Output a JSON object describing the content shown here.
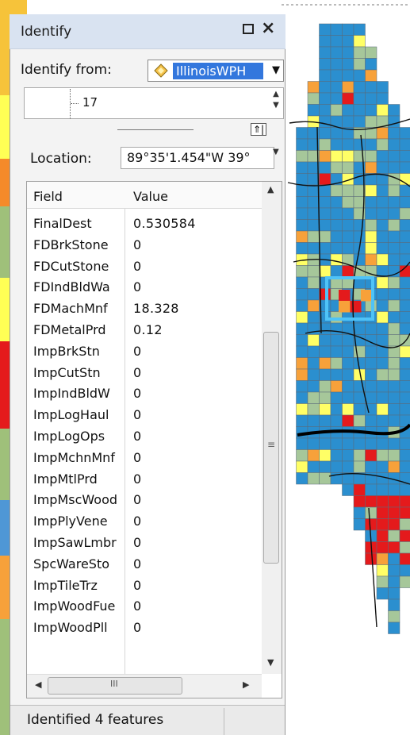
{
  "window": {
    "title": "Identify",
    "float_icon": "maximize-icon",
    "close_glyph": "×",
    "close_icon": "close-icon"
  },
  "identify_from": {
    "label": "Identify from:",
    "selected": "IllinoisWPH",
    "layer_icon": "layer-icon",
    "dropdown_arrow": "▼"
  },
  "tree": {
    "item": "17",
    "scroll_up": "▲",
    "scroll_down": "▼"
  },
  "splitter": {
    "buttons": "⇑|"
  },
  "location": {
    "label": "Location:",
    "value": "89°35'1.454\"W  39°",
    "arrow": "▼"
  },
  "grid": {
    "header_field": "Field",
    "header_value": "Value",
    "rows": [
      {
        "field": "FinalDest",
        "value": "0.530584"
      },
      {
        "field": "FDBrkStone",
        "value": "0"
      },
      {
        "field": "FDCutStone",
        "value": "0"
      },
      {
        "field": "FDIndBldWa",
        "value": "0"
      },
      {
        "field": "FDMachMnf",
        "value": "18.328"
      },
      {
        "field": "FDMetalPrd",
        "value": "0.12"
      },
      {
        "field": "ImpBrkStn",
        "value": "0"
      },
      {
        "field": "ImpCutStn",
        "value": "0"
      },
      {
        "field": "ImpIndBldW",
        "value": "0"
      },
      {
        "field": "ImpLogHaul",
        "value": "0"
      },
      {
        "field": "ImpLogOps",
        "value": "0"
      },
      {
        "field": "ImpMchnMnf",
        "value": "0"
      },
      {
        "field": "ImpMtlPrd",
        "value": "0"
      },
      {
        "field": "ImpMscWood",
        "value": "0"
      },
      {
        "field": "ImpPlyVene",
        "value": "0"
      },
      {
        "field": "ImpSawLmbr",
        "value": "0"
      },
      {
        "field": "SpcWareSto",
        "value": "0"
      },
      {
        "field": "ImpTileTrz",
        "value": "0"
      },
      {
        "field": "ImpWoodFue",
        "value": "0"
      },
      {
        "field": "ImpWoodPll",
        "value": "0"
      }
    ],
    "vscroll_up": "▲",
    "vscroll_down": "▼",
    "vscroll_grip": "≡",
    "hscroll_left": "◀",
    "hscroll_right": "▶",
    "hscroll_grip": "III"
  },
  "status": {
    "text": "Identified 4 features"
  },
  "map": {
    "colors": {
      "blue": "#2b8fcf",
      "sage": "#a6c79a",
      "yellow": "#ffff66",
      "orange": "#f7a13a",
      "red": "#e41a1c",
      "selection": "#4fc3f7",
      "left_strip": [
        "#f6c33a",
        "#ffff55",
        "#9fc07a",
        "#f58a2a",
        "#e41a1c",
        "#4f97d6",
        "#f7a13a"
      ]
    }
  }
}
